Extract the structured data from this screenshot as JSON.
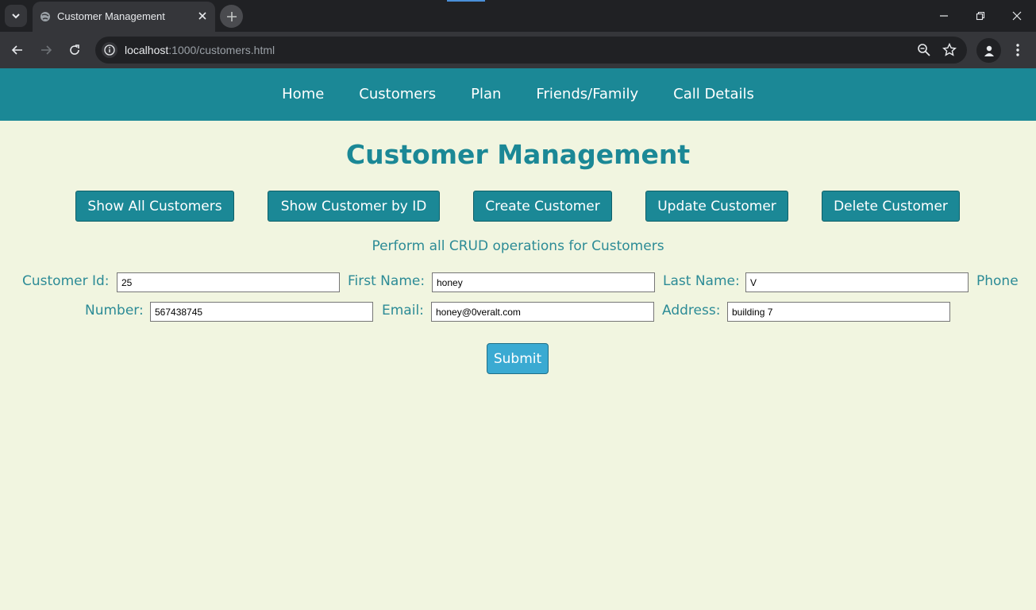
{
  "browser": {
    "tab_title": "Customer Management",
    "url_host": "localhost",
    "url_path": ":1000/customers.html"
  },
  "nav": {
    "items": [
      "Home",
      "Customers",
      "Plan",
      "Friends/Family",
      "Call Details"
    ]
  },
  "page": {
    "title": "Customer Management",
    "actions": [
      "Show All Customers",
      "Show Customer by ID",
      "Create Customer",
      "Update Customer",
      "Delete Customer"
    ],
    "subtitle": "Perform all CRUD operations for Customers"
  },
  "form": {
    "customer_id": {
      "label": "Customer Id:",
      "value": "25"
    },
    "first_name": {
      "label": "First Name:",
      "value": "honey"
    },
    "last_name": {
      "label": "Last Name:",
      "value": "V"
    },
    "phone_label_line1": "Phone",
    "phone_label_line2": "Number:",
    "phone_value": "567438745",
    "email": {
      "label": "Email:",
      "value": "honey@0veralt.com"
    },
    "address": {
      "label": "Address:",
      "value": "building 7"
    },
    "submit_label": "Submit"
  },
  "colors": {
    "nav_bg": "#1b8896",
    "page_bg": "#f1f5e0",
    "submit_bg": "#3aaad2"
  }
}
